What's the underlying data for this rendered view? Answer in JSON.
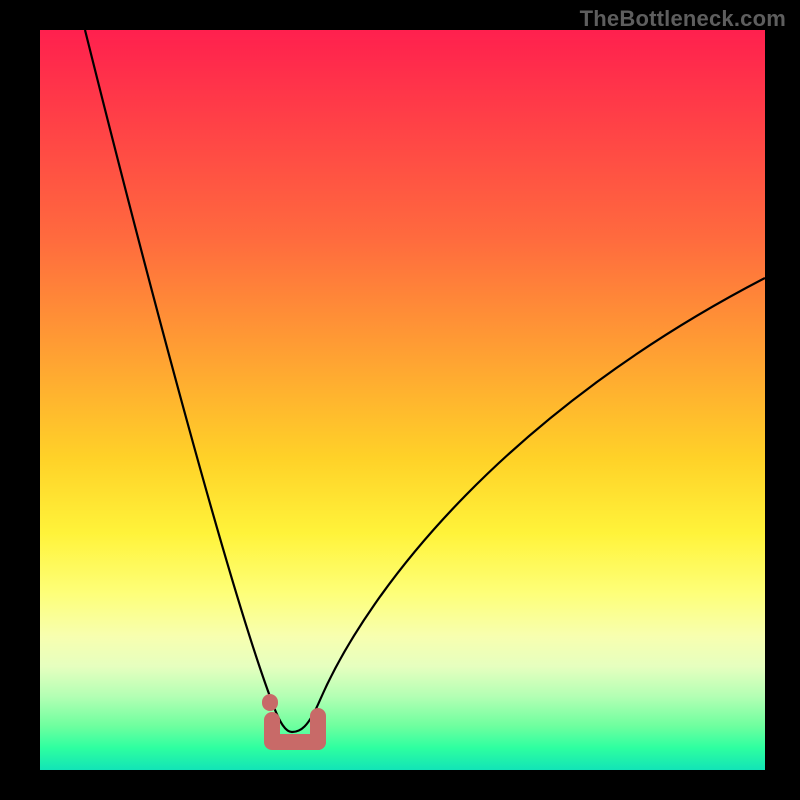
{
  "watermark": "TheBottleneck.com",
  "chart_data": {
    "type": "line",
    "title": "",
    "xlabel": "",
    "ylabel": "",
    "ylim": [
      0,
      100
    ],
    "xlim": [
      0,
      100
    ],
    "series": [
      {
        "name": "bottleneck-curve",
        "x": [
          6,
          10,
          14,
          18,
          22,
          26,
          29,
          31,
          33,
          35,
          37,
          40,
          44,
          50,
          58,
          68,
          80,
          92,
          100
        ],
        "values": [
          100,
          88,
          74,
          60,
          46,
          32,
          20,
          12,
          6,
          4,
          6,
          12,
          22,
          34,
          46,
          58,
          68,
          76,
          80
        ]
      }
    ],
    "markers": {
      "description": "salmon rounded bracket at curve minimum",
      "x_range": [
        31.5,
        37
      ],
      "y": 4
    },
    "background_gradient": {
      "top": "#ff204e",
      "middle": "#fff33a",
      "bottom": "#12e4b7"
    }
  }
}
